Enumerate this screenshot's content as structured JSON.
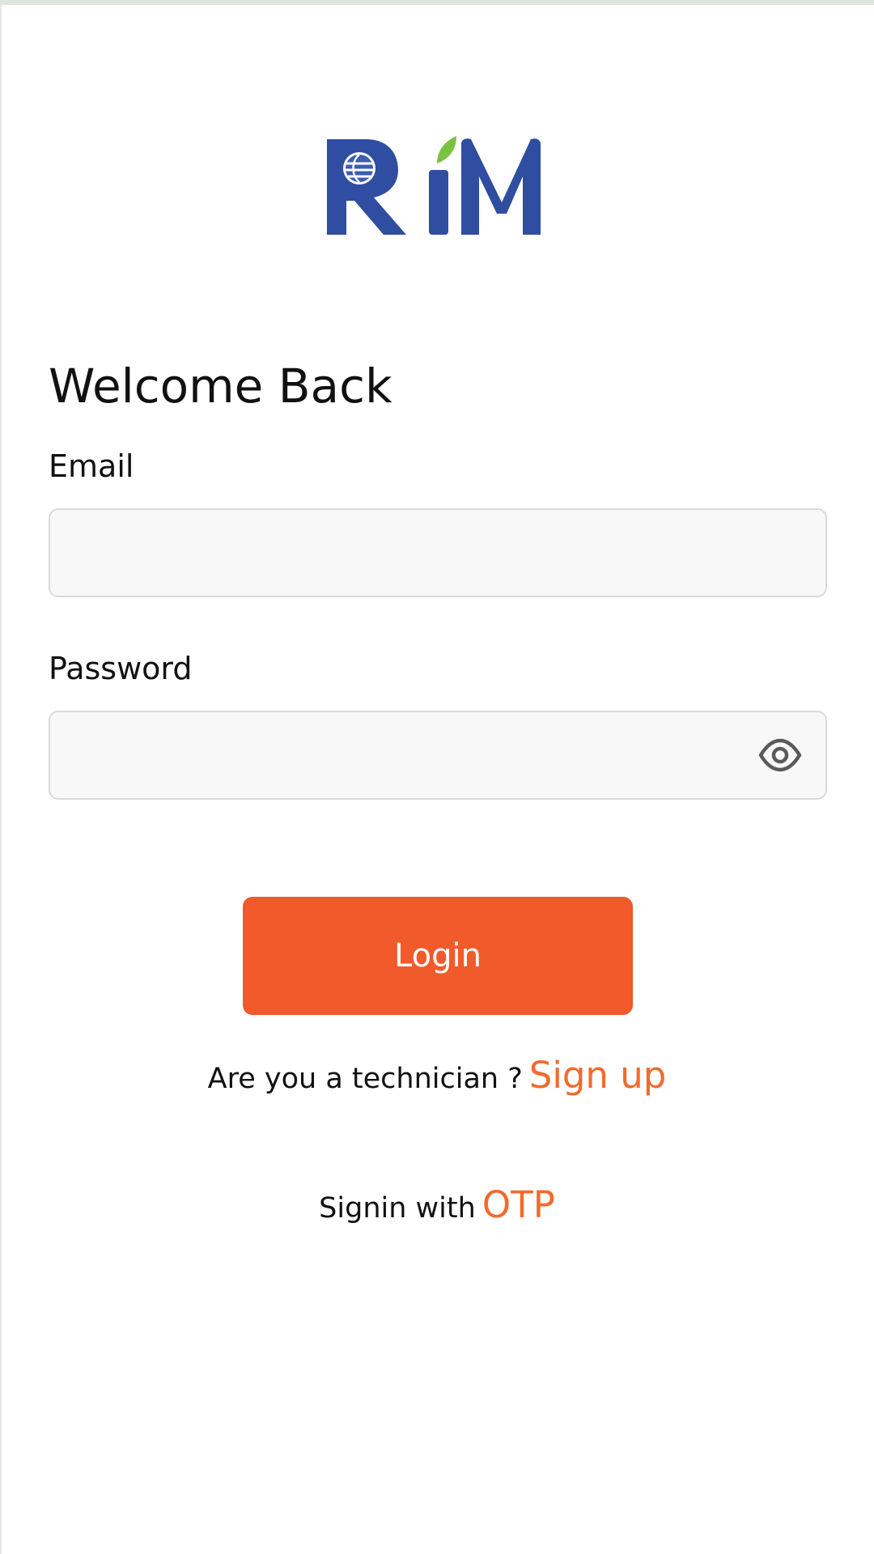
{
  "brand": {
    "logo_text": "RiM",
    "primary_color": "#2f4ea1",
    "accent_color": "#7cc242"
  },
  "login_form": {
    "heading": "Welcome Back",
    "email": {
      "label": "Email",
      "value": "",
      "placeholder": ""
    },
    "password": {
      "label": "Password",
      "value": "",
      "placeholder": "",
      "visibility_icon": "eye-icon"
    },
    "submit_label": "Login",
    "submit_color": "#f15a2a"
  },
  "signup_prompt": {
    "text": "Are you a technician ?",
    "link_label": "Sign up"
  },
  "otp_prompt": {
    "text": "Signin with",
    "link_label": "OTP"
  },
  "link_color": "#f26a2c"
}
